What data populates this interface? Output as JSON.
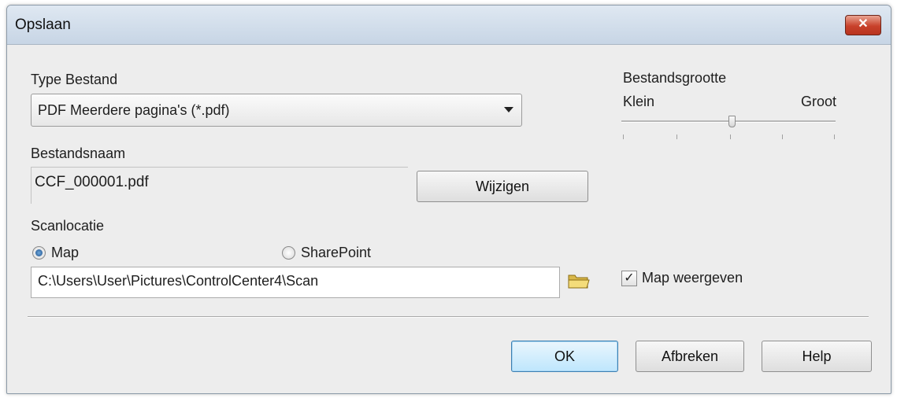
{
  "window": {
    "title": "Opslaan",
    "close_glyph": "✕"
  },
  "file_type": {
    "label": "Type Bestand",
    "selected": "PDF Meerdere pagina's (*.pdf)"
  },
  "file_size": {
    "label": "Bestandsgrootte",
    "min_label": "Klein",
    "max_label": "Groot",
    "level": 0.5
  },
  "file_name": {
    "label": "Bestandsnaam",
    "value": "CCF_000001.pdf",
    "change_button": "Wijzigen"
  },
  "scan_location": {
    "label": "Scanlocatie",
    "option_map": "Map",
    "option_sharepoint": "SharePoint",
    "selected": "Map",
    "path": "C:\\Users\\User\\Pictures\\ControlCenter4\\Scan",
    "browse_icon": "folder-icon",
    "show_folder_label": "Map weergeven",
    "show_folder_checked": true,
    "check_glyph": "✓"
  },
  "buttons": {
    "ok": "OK",
    "cancel": "Afbreken",
    "help": "Help"
  },
  "colors": {
    "title_bar": "#c7d5e5",
    "close_button": "#c8412a",
    "default_button_border": "#3c7fb1"
  }
}
